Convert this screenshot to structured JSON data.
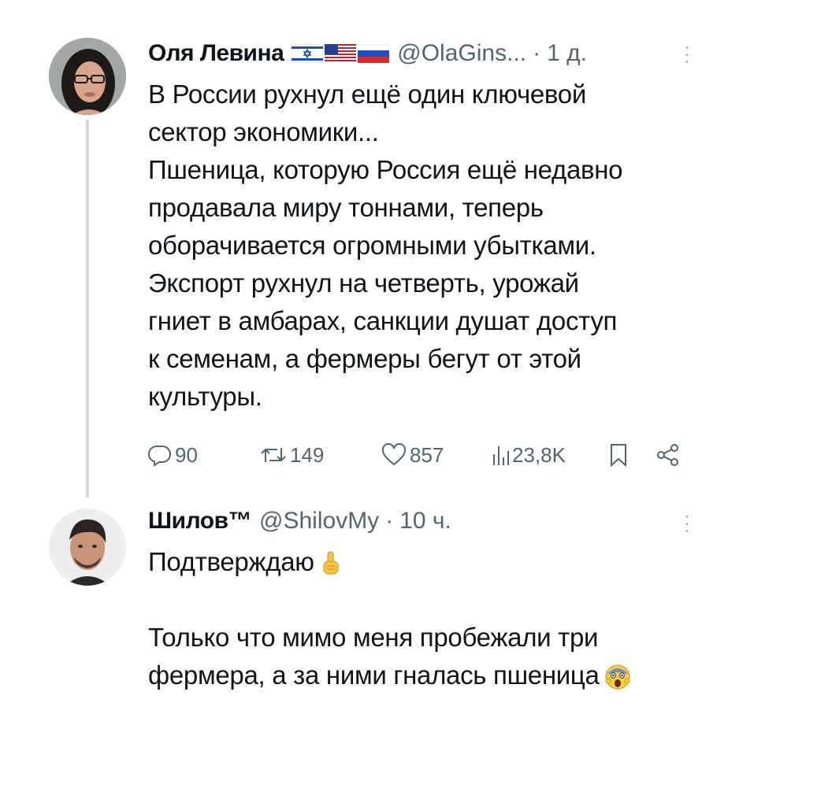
{
  "post": {
    "author_name": "Оля Левина",
    "flags": [
      "israel-flag",
      "usa-flag",
      "russia-flag"
    ],
    "handle": "@OlaGins...",
    "separator": "·",
    "time": "1 д.",
    "text_lines": [
      "В России рухнул ещё один ключевой",
      "сектор экономики...",
      "Пшеница, которую Россия ещё недавно",
      "продавала миру тоннами, теперь",
      "оборачивается огромными убытками.",
      "Экспорт рухнул на четверть, урожай",
      "гниет в амбарах, санкции душат доступ",
      "к семенам, а фермеры бегут от этой",
      "культуры."
    ],
    "actions": {
      "replies": "90",
      "reposts": "149",
      "likes": "857",
      "views": "23,8K"
    }
  },
  "reply": {
    "author_name": "Шилов™",
    "handle": "@ShilovMy",
    "separator": "·",
    "time": "10 ч.",
    "line1": "Подтверждаю",
    "line1_emoji": "pointing-up-emoji",
    "line2": "Только что мимо меня пробежали три",
    "line3": "фермера, а за ними гналась пшеница",
    "line3_emoji": "screaming-face-emoji"
  },
  "colors": {
    "text": "#0f1419",
    "secondary": "#536471",
    "thread_line": "#cfd9de"
  }
}
